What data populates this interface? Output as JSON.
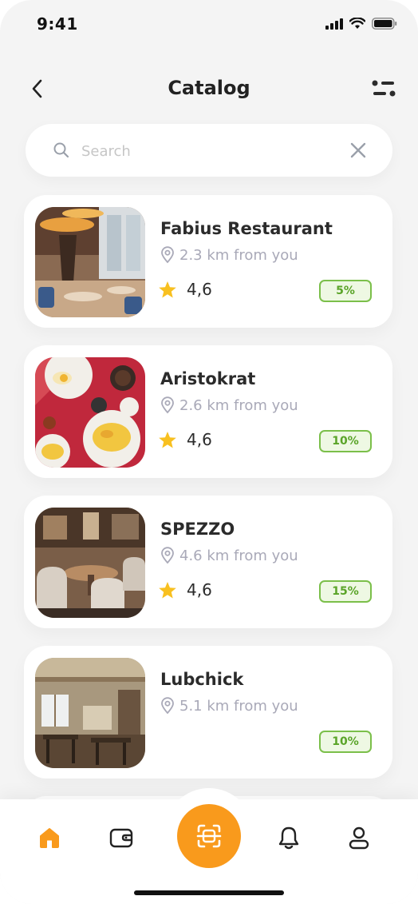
{
  "status_bar": {
    "time": "9:41"
  },
  "header": {
    "title": "Catalog"
  },
  "search": {
    "placeholder": "Search",
    "value": ""
  },
  "colors": {
    "accent": "#f99a1c",
    "discount_border": "#7bbf4a",
    "discount_text": "#5aa428",
    "muted_text": "#a9a9b8",
    "star": "#f8c020"
  },
  "restaurants": [
    {
      "name": "Fabius Restaurant",
      "distance": "2.3 km from you",
      "rating": "4,6",
      "discount": "5%",
      "image": "restaurant-interior-chandelier"
    },
    {
      "name": "Aristokrat",
      "distance": "2.6 km from you",
      "rating": "4,6",
      "discount": "10%",
      "image": "breakfast-table-top-view"
    },
    {
      "name": "SPEZZO",
      "distance": "4.6 km from you",
      "rating": "4,6",
      "discount": "15%",
      "image": "restaurant-dining-room-chairs"
    },
    {
      "name": "Lubchick",
      "distance": "5.1 km from you",
      "rating": "",
      "discount": "10%",
      "image": "wooden-cafe-interior"
    }
  ],
  "bottom_nav": {
    "items": [
      "home-icon",
      "wallet-icon",
      "scan-icon",
      "bell-icon",
      "profile-icon"
    ],
    "active": "home-icon"
  }
}
